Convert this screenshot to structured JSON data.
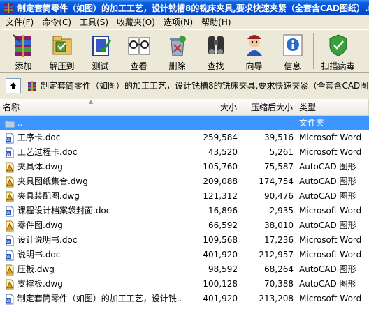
{
  "window": {
    "title": "制定套筒零件（如图）的加工工艺，设计铣槽8的铣床夹具,要求快速夹紧（全套含CAD图纸）.ra"
  },
  "menu": [
    "文件(F)",
    "命令(C)",
    "工具(S)",
    "收藏夹(O)",
    "选项(N)",
    "帮助(H)"
  ],
  "toolbar": {
    "buttons": [
      {
        "label": "添加",
        "icon": "add-archive-icon"
      },
      {
        "label": "解压到",
        "icon": "extract-to-icon"
      },
      {
        "label": "测试",
        "icon": "test-icon"
      },
      {
        "label": "查看",
        "icon": "view-icon"
      },
      {
        "label": "删除",
        "icon": "delete-icon"
      },
      {
        "label": "查找",
        "icon": "find-icon"
      },
      {
        "label": "向导",
        "icon": "wizard-icon"
      },
      {
        "label": "信息",
        "icon": "info-icon"
      },
      {
        "label": "扫描病毒",
        "icon": "virus-scan-icon"
      }
    ]
  },
  "address": {
    "path": "制定套筒零件（如图）的加工工艺，设计铣槽8的铣床夹具,要求快速夹紧（全套含CAD图"
  },
  "columns": {
    "name": "名称",
    "size": "大小",
    "packed": "压缩后大小",
    "type": "类型"
  },
  "files": [
    {
      "name": "..",
      "size": "",
      "packed": "",
      "type": "文件夹",
      "kind": "folder",
      "selected": true
    },
    {
      "name": "工序卡.doc",
      "size": "259,584",
      "packed": "39,516",
      "type": "Microsoft Word",
      "kind": "doc"
    },
    {
      "name": "工艺过程卡.doc",
      "size": "43,520",
      "packed": "5,261",
      "type": "Microsoft Word",
      "kind": "doc"
    },
    {
      "name": "夹具体.dwg",
      "size": "105,760",
      "packed": "75,587",
      "type": "AutoCAD 图形",
      "kind": "dwg"
    },
    {
      "name": "夹具图纸集合.dwg",
      "size": "209,088",
      "packed": "174,754",
      "type": "AutoCAD 图形",
      "kind": "dwg"
    },
    {
      "name": "夹具装配图.dwg",
      "size": "121,312",
      "packed": "90,476",
      "type": "AutoCAD 图形",
      "kind": "dwg"
    },
    {
      "name": "课程设计档案袋封面.doc",
      "size": "16,896",
      "packed": "2,935",
      "type": "Microsoft Word",
      "kind": "doc"
    },
    {
      "name": "零件图.dwg",
      "size": "66,592",
      "packed": "38,010",
      "type": "AutoCAD 图形",
      "kind": "dwg"
    },
    {
      "name": "设计说明书.doc",
      "size": "109,568",
      "packed": "17,236",
      "type": "Microsoft Word",
      "kind": "doc"
    },
    {
      "name": "说明书.doc",
      "size": "401,920",
      "packed": "212,957",
      "type": "Microsoft Word",
      "kind": "doc"
    },
    {
      "name": "压板.dwg",
      "size": "98,592",
      "packed": "68,264",
      "type": "AutoCAD 图形",
      "kind": "dwg"
    },
    {
      "name": "支撑板.dwg",
      "size": "100,128",
      "packed": "70,388",
      "type": "AutoCAD 图形",
      "kind": "dwg"
    },
    {
      "name": "制定套筒零件（如图）的加工工艺，设计铣...",
      "size": "401,920",
      "packed": "213,208",
      "type": "Microsoft Word",
      "kind": "doc"
    }
  ],
  "colors": {
    "titlebar": "#0551d8",
    "selection": "#3d95ff"
  }
}
